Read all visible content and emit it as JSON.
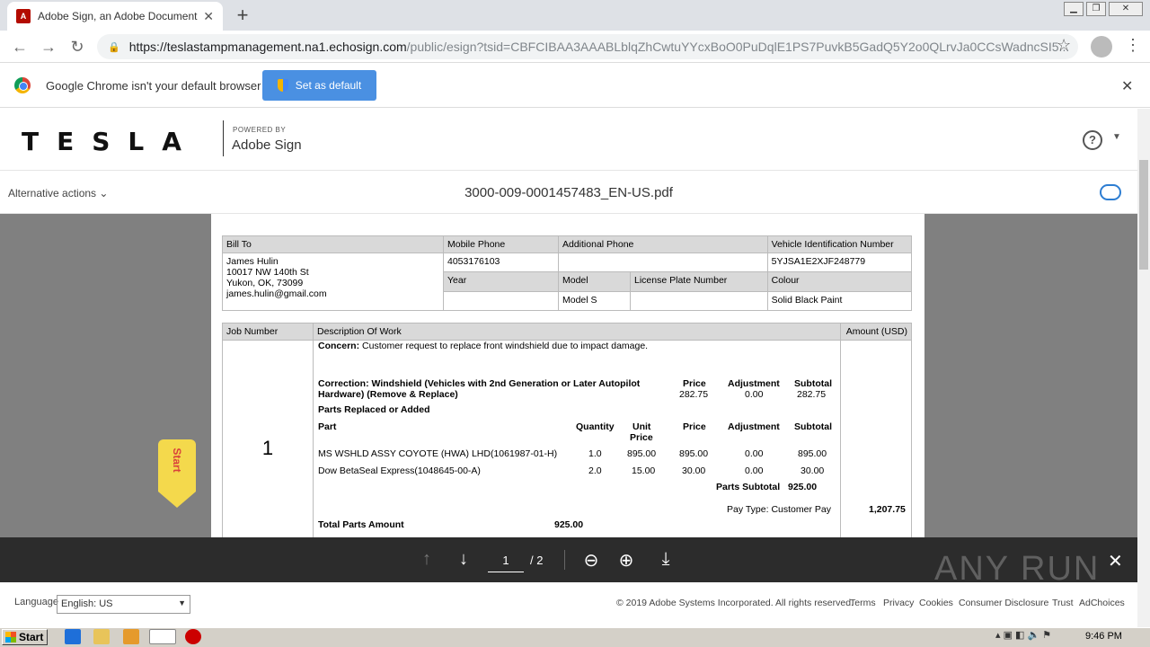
{
  "browser": {
    "tab_title": "Adobe Sign, an Adobe Document Clo",
    "url_host": "https://teslastampmanagement.na1.echosign.com",
    "url_path": "/public/esign?tsid=CBFCIBAA3AAABLblqZhCwtuYYcxBoO0PuDqlE1PS7PuvkB5GadQ5Y2o0QLrvJa0CCsWadncSI5...",
    "infobar_message": "Google Chrome isn't your default browser",
    "set_default_label": "Set as default"
  },
  "header": {
    "logo_text": "TESLA",
    "powered_by": "POWERED BY",
    "product": "Adobe Sign",
    "help_icon_label": "?"
  },
  "subbar": {
    "alt_actions": "Alternative actions",
    "filename": "3000-009-0001457483_EN-US.pdf"
  },
  "document": {
    "bill_to_header": "Bill To",
    "customer_name": "James Hulin",
    "address1": "10017 NW 140th St",
    "address2": "Yukon, OK, 73099",
    "email": "james.hulin@gmail.com",
    "mobile_phone_header": "Mobile Phone",
    "mobile_phone": "4053176103",
    "additional_phone_header": "Additional Phone",
    "vin_header": "Vehicle Identification Number",
    "vin": "5YJSA1E2XJF248779",
    "year_header": "Year",
    "model_header": "Model",
    "model": "Model S",
    "plate_header": "License Plate Number",
    "colour_header": "Colour",
    "colour": "Solid Black Paint",
    "job_header": "Job Number",
    "description_header": "Description Of Work",
    "amount_header": "Amount (USD)",
    "job_number": "1",
    "concern_label": "Concern:",
    "concern_text": "Customer request to replace front windshield due to impact damage.",
    "correction_line1": "Correction: Windshield (Vehicles with 2nd Generation or Later Autopilot",
    "correction_line2": "Hardware) (Remove & Replace)",
    "price_header": "Price",
    "adjustment_header": "Adjustment",
    "subtotal_header": "Subtotal",
    "labor_price": "282.75",
    "labor_adjustment": "0.00",
    "labor_subtotal": "282.75",
    "parts_replaced": "Parts Replaced or Added",
    "part_header": "Part",
    "quantity_header": "Quantity",
    "unit_price_header1": "Unit",
    "unit_price_header2": "Price",
    "parts": [
      {
        "name": "MS WSHLD ASSY COYOTE (HWA) LHD(1061987-01-H)",
        "qty": "1.0",
        "unit": "895.00",
        "price": "895.00",
        "adj": "0.00",
        "subtotal": "895.00"
      },
      {
        "name": "Dow BetaSeal Express(1048645-00-A)",
        "qty": "2.0",
        "unit": "15.00",
        "price": "30.00",
        "adj": "0.00",
        "subtotal": "30.00"
      }
    ],
    "parts_subtotal_label": "Parts Subtotal",
    "parts_subtotal": "925.00",
    "pay_type_label": "Pay Type:",
    "pay_type": "Customer Pay",
    "job_amount": "1,207.75",
    "total_parts_label": "Total Parts Amount",
    "total_parts": "925.00"
  },
  "start_tag": "Start",
  "pager": {
    "current_page": "1",
    "total_pages": "/ 2"
  },
  "footer": {
    "language_label": "Language",
    "language_value": "English: US",
    "copyright": "© 2019 Adobe Systems Incorporated. All rights reserved.",
    "links": [
      "Terms",
      "Privacy",
      "Cookies",
      "Consumer Disclosure",
      "Trust",
      "AdChoices"
    ]
  },
  "watermark": "ANY RUN",
  "taskbar": {
    "start_label": "Start",
    "clock": "9:46 PM"
  }
}
